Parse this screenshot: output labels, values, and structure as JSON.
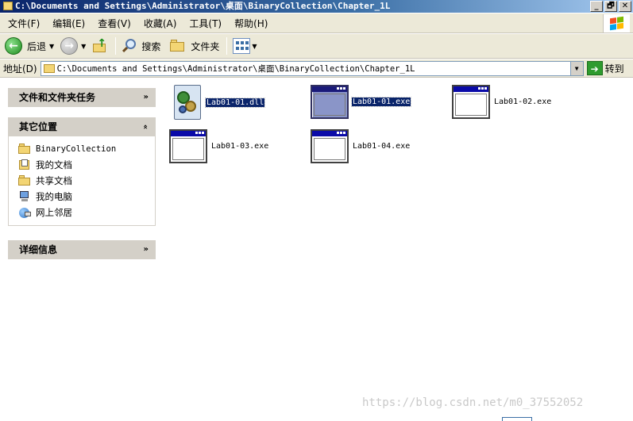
{
  "window": {
    "title": "C:\\Documents and Settings\\Administrator\\桌面\\BinaryCollection\\Chapter_1L",
    "controls": [
      "_",
      "🗗",
      "✕"
    ]
  },
  "menu": [
    "文件(F)",
    "编辑(E)",
    "查看(V)",
    "收藏(A)",
    "工具(T)",
    "帮助(H)"
  ],
  "toolbar": {
    "back": "后退",
    "search": "搜索",
    "folders": "文件夹"
  },
  "address": {
    "label": "地址(D)",
    "value": "C:\\Documents and Settings\\Administrator\\桌面\\BinaryCollection\\Chapter_1L",
    "go": "转到"
  },
  "taskpane": {
    "tasks_header": "文件和文件夹任务",
    "places_header": "其它位置",
    "places": [
      {
        "label": "BinaryCollection",
        "icon": "folder-icon"
      },
      {
        "label": "我的文档",
        "icon": "my-documents-icon"
      },
      {
        "label": "共享文档",
        "icon": "folder-icon"
      },
      {
        "label": "我的电脑",
        "icon": "my-computer-icon"
      },
      {
        "label": "网上邻居",
        "icon": "network-icon"
      }
    ],
    "details_header": "详细信息"
  },
  "files": [
    {
      "name": "Lab01-01.dll",
      "type": "dll",
      "selected": true
    },
    {
      "name": "Lab01-01.exe",
      "type": "exe",
      "selected": true
    },
    {
      "name": "Lab01-02.exe",
      "type": "exe",
      "selected": false
    },
    {
      "name": "Lab01-03.exe",
      "type": "exe",
      "selected": false
    },
    {
      "name": "Lab01-04.exe",
      "type": "exe",
      "selected": false
    }
  ],
  "watermark": "https://blog.csdn.net/m0_37552052"
}
